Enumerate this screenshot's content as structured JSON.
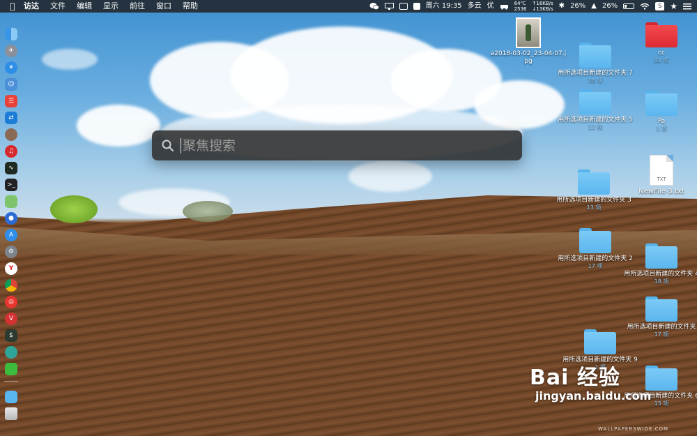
{
  "menubar": {
    "app_name": "访达",
    "menus": [
      "文件",
      "编辑",
      "显示",
      "前往",
      "窗口",
      "帮助"
    ],
    "cpu_temp": "64℃",
    "fan": "2536",
    "net_up": "↑16KB/s",
    "net_down": "↓13KB/s",
    "datetime": "周六 19:35",
    "weather": "多云",
    "air_quality": "优",
    "battery_1": "26%",
    "battery_2": "26%"
  },
  "spotlight": {
    "placeholder": "聚焦搜索"
  },
  "desktop_items": [
    {
      "name": "a2018-03-02_23-04-07.jpg",
      "count": "",
      "kind": "image"
    },
    {
      "name": "cc",
      "count": "92 项",
      "kind": "red-folder"
    },
    {
      "name": "用所选项目新建的文件夹 7",
      "count": "16 项",
      "kind": "folder"
    },
    {
      "name": "用所选项目新建的文件夹 5",
      "count": "12 项",
      "kind": "folder"
    },
    {
      "name": "Pa",
      "count": "1 项",
      "kind": "folder"
    },
    {
      "name": "NewFile-3.txt",
      "count": "",
      "kind": "txt"
    },
    {
      "name": "用所选项目新建的文件夹 3",
      "count": "13 项",
      "kind": "folder"
    },
    {
      "name": "用所选项目新建的文件夹 2",
      "count": "17 项",
      "kind": "folder"
    },
    {
      "name": "用所选项目新建的文件夹 4",
      "count": "18 项",
      "kind": "folder"
    },
    {
      "name": "用所选项目新建的文件夹",
      "count": "17 项",
      "kind": "folder"
    },
    {
      "name": "用所选项目新建的文件夹 9",
      "count": "2 项",
      "kind": "folder"
    },
    {
      "name": "用所选项目新建的文件夹 6",
      "count": "15 项",
      "kind": "folder"
    }
  ],
  "doc_label": "TXT",
  "dock": [
    "finder-icon",
    "launchpad-icon",
    "safari-icon",
    "contacts-icon",
    "calendar-icon",
    "teamviewer-icon",
    "disk-icon",
    "netease-music-icon",
    "activity-monitor-icon",
    "terminal-icon",
    "maps-icon",
    "siri-icon",
    "app-store-icon",
    "system-preferences-icon",
    "yandex-icon",
    "chrome-icon",
    "weibo-icon",
    "vivaldi-icon",
    "console-icon",
    "cleaner-icon",
    "wechat-icon",
    "downloads-icon",
    "trash-icon"
  ],
  "watermark": {
    "brand": "Bai 经验",
    "url": "jingyan.baidu.com",
    "site": "WALLPAPERSWIDE.COM"
  }
}
